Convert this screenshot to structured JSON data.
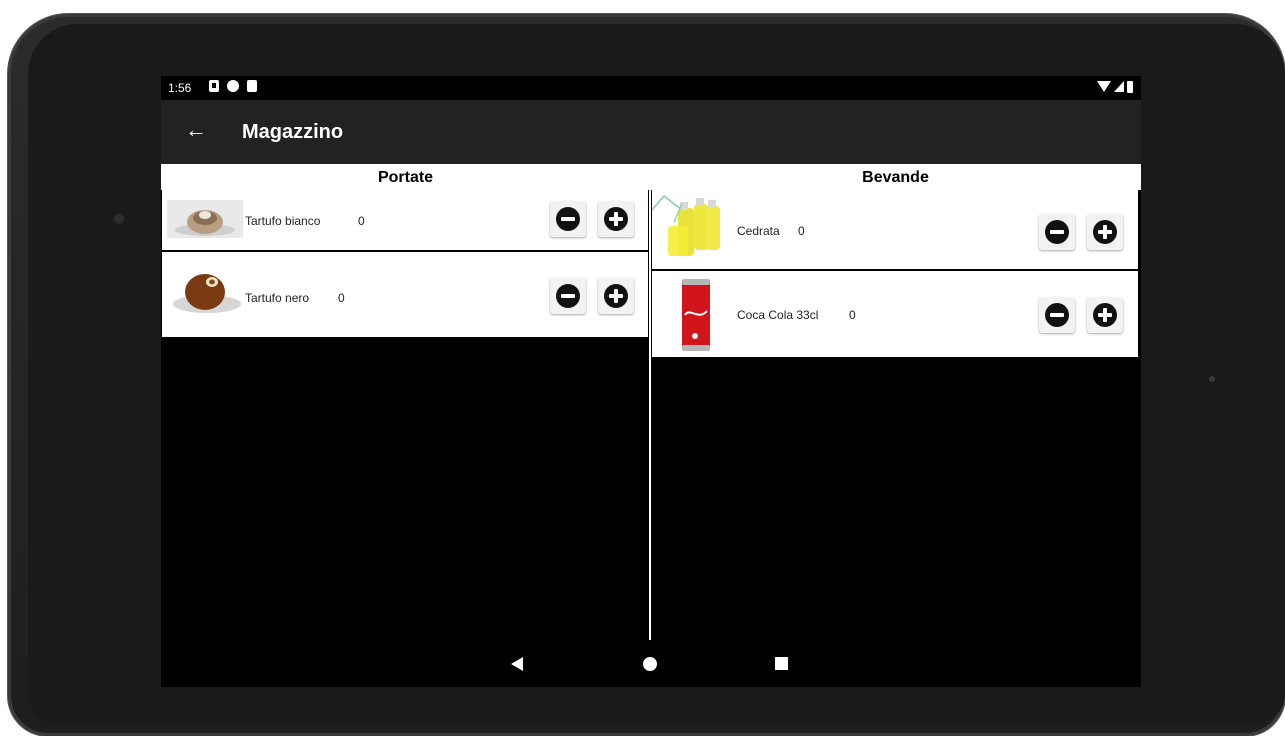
{
  "status": {
    "time": "1:56"
  },
  "appbar": {
    "title": "Magazzino",
    "back_icon": "arrow-back-icon"
  },
  "columns": {
    "left": {
      "header": "Portate",
      "items": [
        {
          "name": "Tartufo bianco",
          "qty": "0",
          "image": "tartufo-bianco-image"
        },
        {
          "name": "Tartufo nero",
          "qty": "0",
          "image": "tartufo-nero-image"
        }
      ]
    },
    "right": {
      "header": "Bevande",
      "items": [
        {
          "name": "Cedrata",
          "qty": "0",
          "image": "cedrata-image"
        },
        {
          "name": "Coca Cola 33cl",
          "qty": "0",
          "image": "coca-cola-image"
        }
      ]
    }
  },
  "buttons": {
    "minus_icon": "minus-circle-icon",
    "plus_icon": "plus-circle-icon"
  },
  "navbar": {
    "back": "nav-back-icon",
    "home": "nav-home-icon",
    "recents": "nav-recents-icon"
  }
}
